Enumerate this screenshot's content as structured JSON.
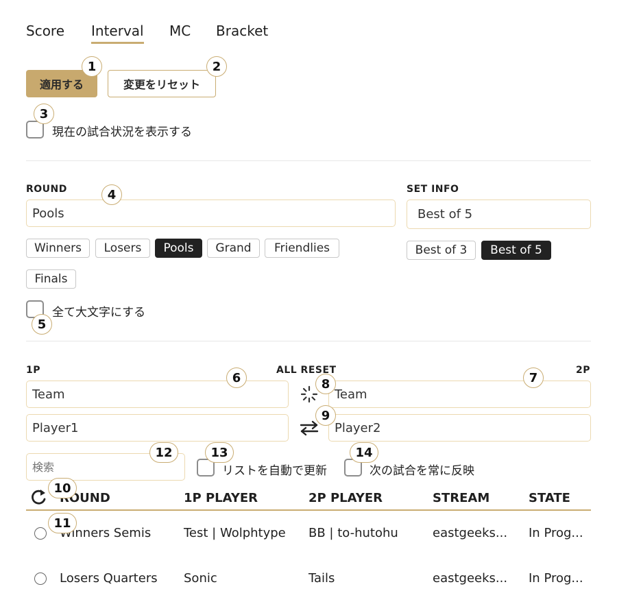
{
  "tabs": [
    "Score",
    "Interval",
    "MC",
    "Bracket"
  ],
  "actions": {
    "apply": "適用する",
    "reset": "変更をリセット"
  },
  "show_status_label": "現在の試合状況を表示する",
  "round": {
    "label": "ROUND",
    "value": "Pools",
    "presets": [
      "Winners",
      "Losers",
      "Pools",
      "Grand",
      "Friendlies",
      "Finals"
    ],
    "selected": "Pools"
  },
  "set_info": {
    "label": "SET INFO",
    "value": "Best of 5",
    "presets": [
      "Best of 3",
      "Best of 5"
    ],
    "selected": "Best of 5"
  },
  "uppercase_label": "全て大文字にする",
  "players": {
    "p1_label": "1P",
    "p2_label": "2P",
    "all_reset": "ALL RESET",
    "p1_team": "Team",
    "p1_player": "Player1",
    "p2_team": "Team",
    "p2_player": "Player2"
  },
  "search": {
    "placeholder": "検索"
  },
  "auto_update_label": "リストを自動で更新",
  "reflect_next_label": "次の試合を常に反映",
  "table": {
    "headers": [
      "ROUND",
      "1P PLAYER",
      "2P PLAYER",
      "STREAM",
      "STATE"
    ],
    "rows": [
      [
        "Winners Semis",
        "Test | Wolphtype",
        "BB | to-hutohu",
        "eastgeeks...",
        "In Prog..."
      ],
      [
        "Losers Quarters",
        "Sonic",
        "Tails",
        "eastgeeks...",
        "In Prog..."
      ]
    ]
  },
  "badges": [
    "1",
    "2",
    "3",
    "4",
    "5",
    "6",
    "7",
    "8",
    "9",
    "10",
    "11",
    "12",
    "13",
    "14"
  ],
  "colors": {
    "accent": "#c8a96e",
    "selected_chip": "#222222",
    "input_border": "#ecd9b0"
  }
}
